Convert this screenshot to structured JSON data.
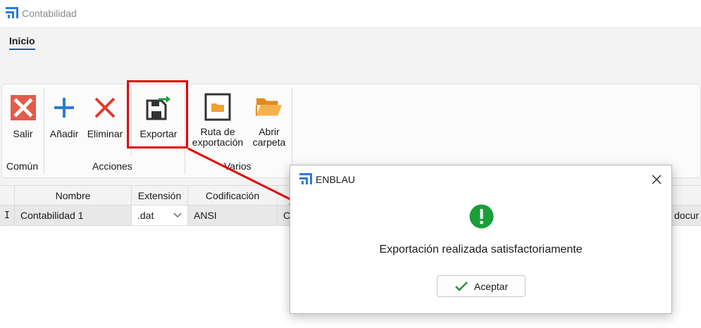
{
  "window": {
    "title": "Contabilidad"
  },
  "tabs": [
    {
      "label": "Inicio"
    }
  ],
  "ribbon": {
    "buttons": {
      "salir": "Salir",
      "anadir": "Añadir",
      "eliminar": "Eliminar",
      "exportar": "Exportar",
      "ruta_line1": "Ruta de",
      "ruta_line2": "exportación",
      "abrir_line1": "Abrir",
      "abrir_line2": "carpeta"
    },
    "groups": {
      "comun": "Común",
      "acciones": "Acciones",
      "varios": "Varios"
    }
  },
  "grid": {
    "columns": [
      "Nombre",
      "Extensión",
      "Codificación"
    ],
    "rows": [
      {
        "marker": "I",
        "nombre": "Contabilidad 1",
        "extension": ".dat",
        "codificacion": "ANSI",
        "next": "C",
        "last": "docur"
      }
    ]
  },
  "dialog": {
    "title": "ENBLAU",
    "message": "Exportación realizada satisfactoriamente",
    "ok_label": "Aceptar"
  },
  "colors": {
    "accent": "#1f5fa8",
    "highlight": "#e30000",
    "success": "#1a9e3a",
    "delete": "#e23a2e",
    "add": "#2b7bd6"
  }
}
